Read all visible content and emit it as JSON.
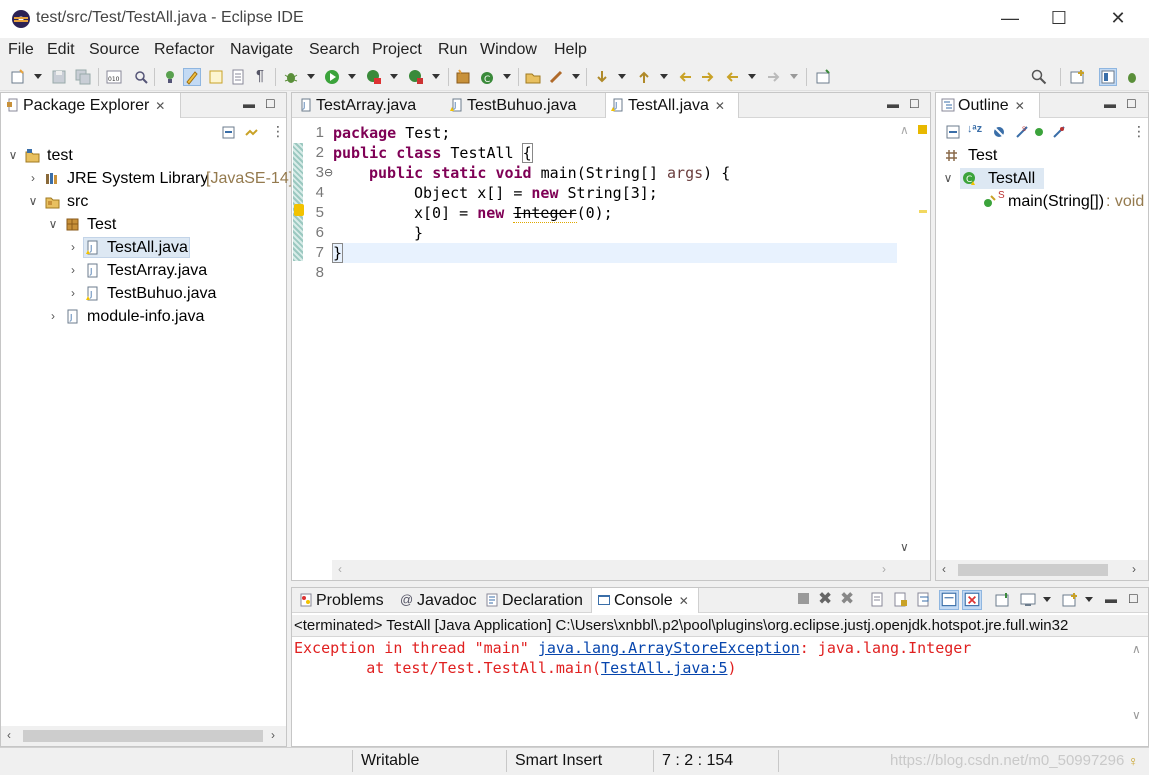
{
  "window": {
    "title": "test/src/Test/TestAll.java - Eclipse IDE"
  },
  "menu": [
    "File",
    "Edit",
    "Source",
    "Refactor",
    "Navigate",
    "Search",
    "Project",
    "Run",
    "Window",
    "Help"
  ],
  "package_explorer": {
    "tab_label": "Package Explorer",
    "tree": [
      {
        "label": "test",
        "icon": "project-icon",
        "expanded": true
      },
      {
        "label": "JRE System Library",
        "suffix": "[JavaSE-14]",
        "icon": "library-icon",
        "expanded": false
      },
      {
        "label": "src",
        "icon": "source-folder-icon",
        "expanded": true
      },
      {
        "label": "Test",
        "icon": "package-icon",
        "expanded": true
      },
      {
        "label": "TestAll.java",
        "icon": "java-file-warning-icon",
        "expanded": false,
        "selected": true
      },
      {
        "label": "TestArray.java",
        "icon": "java-file-icon",
        "expanded": false
      },
      {
        "label": "TestBuhuo.java",
        "icon": "java-file-warning-icon",
        "expanded": false
      },
      {
        "label": "module-info.java",
        "icon": "java-file-icon",
        "expanded": false
      }
    ]
  },
  "editor": {
    "tabs": [
      "TestArray.java",
      "TestBuhuo.java",
      "TestAll.java"
    ],
    "active_tab": "TestAll.java",
    "line_numbers": [
      "1",
      "2",
      "3",
      "4",
      "5",
      "6",
      "7",
      "8"
    ],
    "code": {
      "l1_kw": "package",
      "l1_rest": " Test;",
      "l2_kw1": "public",
      "l2_kw2": "class",
      "l2_rest": " TestAll ",
      "l2_brace": "{",
      "l3_kw1": "public",
      "l3_kw2": "static",
      "l3_kw3": "void",
      "l3_rest1": " main(String[] ",
      "l3_param": "args",
      "l3_rest2": ") {",
      "l4_a": "Object x[] = ",
      "l4_kw": "new",
      "l4_b": " String[3];",
      "l5_a": "x[0] = ",
      "l5_kw": "new",
      "l5_dep": "Integer",
      "l5_b": "(0);",
      "l6": "}",
      "l7": "}"
    },
    "fold_marker": "⊖"
  },
  "outline": {
    "tab_label": "Outline",
    "items": [
      {
        "label": "Test",
        "icon": "package-icon"
      },
      {
        "label": "TestAll",
        "icon": "class-icon",
        "expanded": true
      },
      {
        "label": "main(String[])",
        "suffix": " : void",
        "icon": "method-icon",
        "badge": "S"
      }
    ]
  },
  "bottom": {
    "tabs": [
      "Problems",
      "Javadoc",
      "Declaration",
      "Console"
    ],
    "active_tab": "Console",
    "console_header": "<terminated> TestAll [Java Application] C:\\Users\\xnbbl\\.p2\\pool\\plugins\\org.eclipse.justj.openjdk.hotspot.jre.full.win32",
    "line1_a": "Exception in thread \"main\" ",
    "line1_link": "java.lang.ArrayStoreException",
    "line1_b": ": java.lang.Integer",
    "line2_a": "        at test/Test.TestAll.main(",
    "line2_link": "TestAll.java:5",
    "line2_b": ")"
  },
  "status": {
    "writable": "Writable",
    "insert_mode": "Smart Insert",
    "position": "7 : 2 : 154",
    "watermark": "https://blog.csdn.net/m0_50997296"
  },
  "colors": {
    "keyword": "#7f0055",
    "error": "#e02020",
    "link": "#0645ad",
    "current_line": "#e8f2fe",
    "selection": "#dde8f3"
  }
}
